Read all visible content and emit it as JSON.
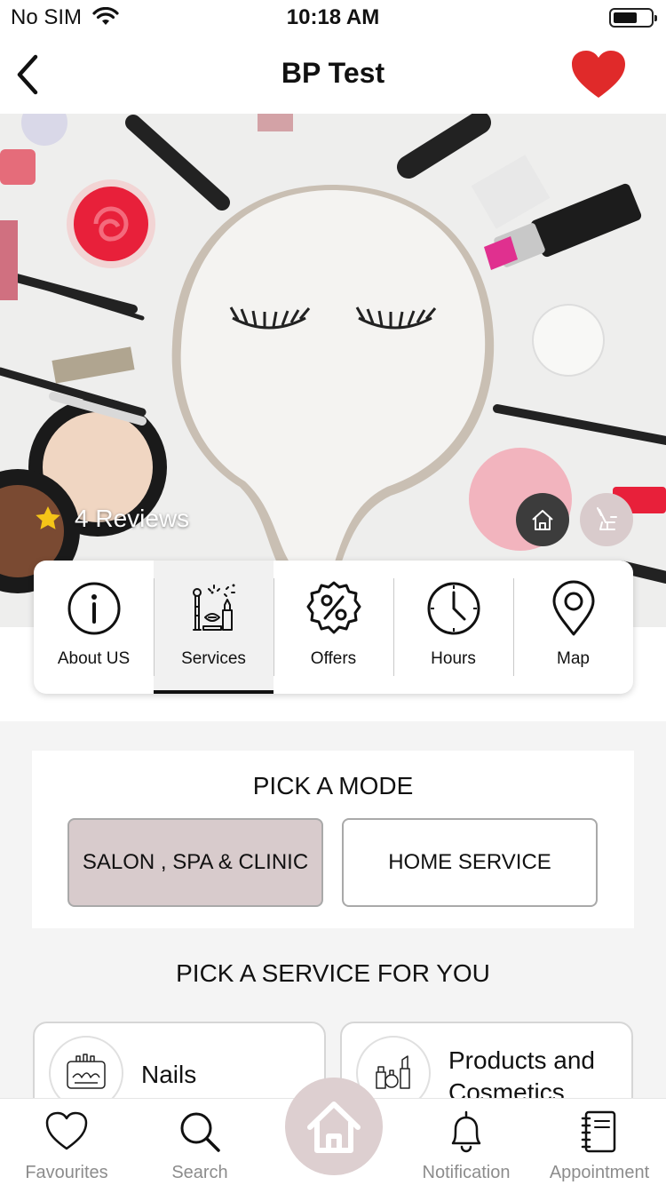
{
  "status_bar": {
    "carrier": "No SIM",
    "time": "10:18 AM"
  },
  "nav": {
    "title": "BP Test",
    "back_icon": "chevron-left-icon",
    "favorite_icon": "heart-icon",
    "favorite_color": "#e02a2a"
  },
  "hero": {
    "rating_text": "4 Reviews",
    "star_color": "#f5c518"
  },
  "tabs": [
    {
      "label": "About US",
      "icon": "info-icon"
    },
    {
      "label": "Services",
      "icon": "makeup-icon",
      "active": true
    },
    {
      "label": "Offers",
      "icon": "percent-badge-icon"
    },
    {
      "label": "Hours",
      "icon": "clock-icon"
    },
    {
      "label": "Map",
      "icon": "map-pin-icon"
    }
  ],
  "mode": {
    "title": "PICK A MODE",
    "options": [
      {
        "label": "SALON , SPA & CLINIC",
        "selected": true
      },
      {
        "label": "HOME SERVICE",
        "selected": false
      }
    ]
  },
  "services": {
    "title": "PICK A SERVICE FOR YOU",
    "items": [
      {
        "label": "Nails",
        "icon": "nails-icon"
      },
      {
        "label": "Products and Cosmetics",
        "icon": "cosmetics-icon"
      }
    ]
  },
  "tab_bar": {
    "items": [
      {
        "label": "Favourites",
        "icon": "heart-outline-icon"
      },
      {
        "label": "Search",
        "icon": "search-icon"
      },
      {
        "label": "",
        "icon": "home-icon"
      },
      {
        "label": "Notification",
        "icon": "bell-icon"
      },
      {
        "label": "Appointment",
        "icon": "notebook-icon"
      }
    ]
  }
}
